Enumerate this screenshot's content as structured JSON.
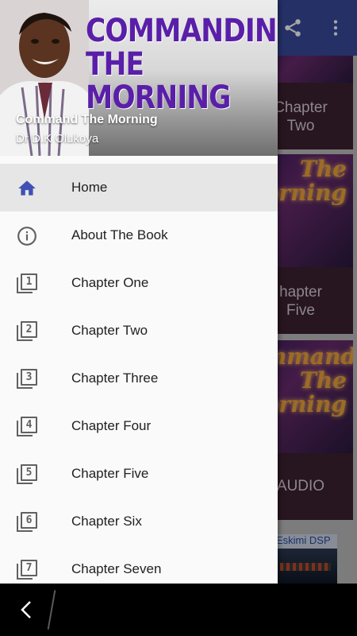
{
  "app": {
    "toolbar_color": "#3a4b9e",
    "actions": [
      {
        "name": "share",
        "icon": "share-icon"
      },
      {
        "name": "more",
        "icon": "more-vert-icon"
      }
    ],
    "cards": [
      {
        "caption_line1": "Chapter",
        "caption_line2": "Two"
      },
      {
        "art_line1": "The",
        "art_line2": "orning",
        "caption_line1": "hapter",
        "caption_line2": "Five"
      },
      {
        "art_line1": "ommand",
        "art_line2": "The",
        "art_line3": "orning",
        "caption_line1": "AUDIO"
      }
    ],
    "ad_label": "Eskimi DSP"
  },
  "drawer": {
    "header": {
      "cover_line1": "COMMANDING",
      "cover_line2": "THE MORNING",
      "title": "Command The Morning",
      "subtitle": "Dr D.K Olukoya"
    },
    "items": [
      {
        "label": "Home",
        "icon": "home-icon",
        "selected": true
      },
      {
        "label": "About The Book",
        "icon": "info-icon"
      },
      {
        "label": "Chapter One",
        "icon": "chapter-1-icon",
        "number": "1"
      },
      {
        "label": "Chapter Two",
        "icon": "chapter-2-icon",
        "number": "2"
      },
      {
        "label": "Chapter Three",
        "icon": "chapter-3-icon",
        "number": "3"
      },
      {
        "label": "Chapter Four",
        "icon": "chapter-4-icon",
        "number": "4"
      },
      {
        "label": "Chapter Five",
        "icon": "chapter-5-icon",
        "number": "5"
      },
      {
        "label": "Chapter Six",
        "icon": "chapter-6-icon",
        "number": "6"
      },
      {
        "label": "Chapter Seven",
        "icon": "chapter-7-icon",
        "number": "7"
      }
    ],
    "accent_color": "#3f51b5"
  }
}
